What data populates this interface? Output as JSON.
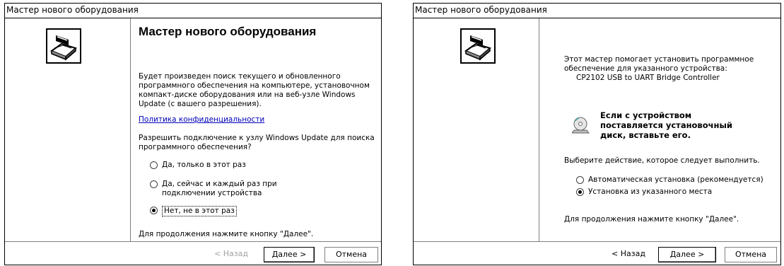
{
  "window1": {
    "title": "Мастер нового оборудования",
    "heading": "Мастер нового оборудования",
    "intro": "Будет произведен поиск текущего и обновленного программного обеспечения на компьютере, установочном компакт-диске оборудования или на веб-узле Windows Update (с вашего разрешения).",
    "privacy_link": "Политика конфиденциальности",
    "question": "Разрешить подключение к узлу Windows Update для поиска программного обеспечения?",
    "options": [
      {
        "label": "Да, только в этот раз",
        "checked": false
      },
      {
        "label": "Да, сейчас и каждый раз при подключении устройства",
        "checked": false
      },
      {
        "label": "Нет, не в этот раз",
        "checked": true
      }
    ],
    "continue_hint": "Для продолжения нажмите кнопку \"Далее\".",
    "back_label": "< Назад",
    "next_label": "Далее >",
    "cancel_label": "Отмена",
    "logo_icon": "hardware-wizard-icon"
  },
  "window2": {
    "title": "Мастер нового оборудования",
    "intro": "Этот мастер помогает установить программное обеспечение для указанного устройства:",
    "device": "CP2102 USB to UART Bridge Controller",
    "cd_hint": "Если с устройством поставляется установочный диск, вставьте его.",
    "action_prompt": "Выберите действие, которое следует выполнить.",
    "options": [
      {
        "label": "Автоматическая установка (рекомендуется)",
        "checked": false
      },
      {
        "label": "Установка из указанного места",
        "checked": true
      }
    ],
    "continue_hint": "Для продолжения нажмите кнопку \"Далее\".",
    "back_label": "< Назад",
    "next_label": "Далее >",
    "cancel_label": "Отмена",
    "logo_icon": "hardware-wizard-icon",
    "cd_icon": "cd-disc-icon"
  }
}
